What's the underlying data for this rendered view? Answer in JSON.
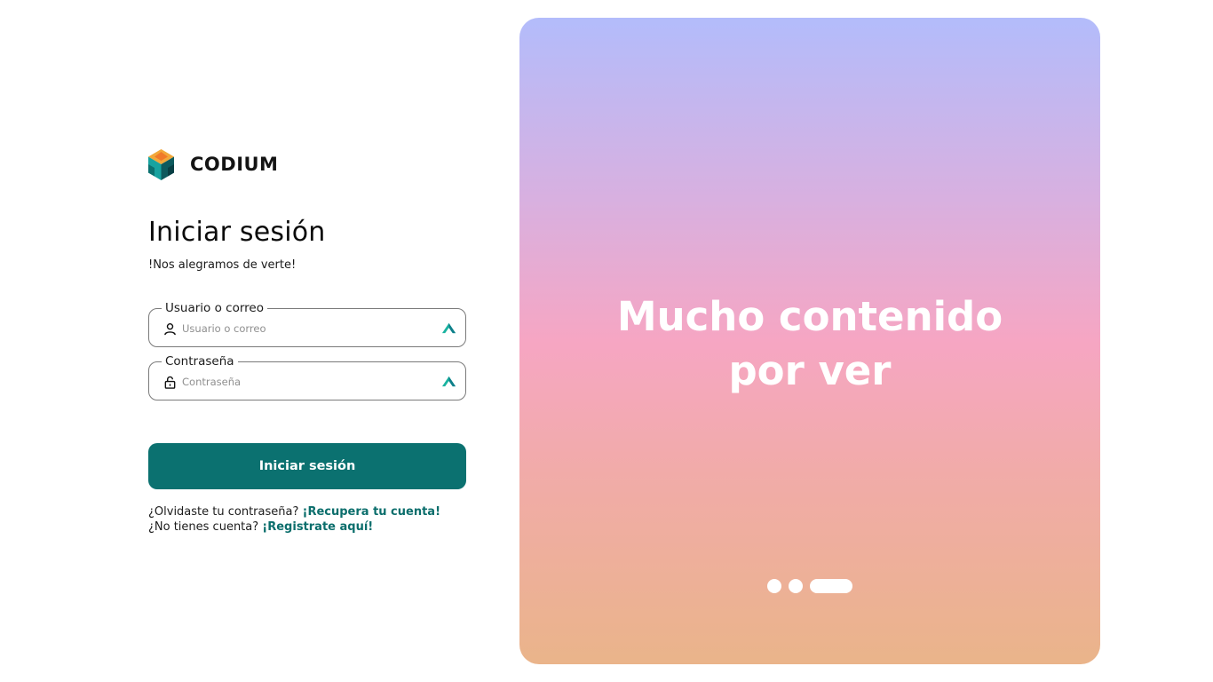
{
  "brand": {
    "name": "CODIUM",
    "logo_icon": "cube-logo-icon"
  },
  "login": {
    "title": "Iniciar sesión",
    "subtitle": "!Nos alegramos de verte!",
    "username": {
      "label": "Usuario o correo",
      "placeholder": "Usuario o correo",
      "value": "",
      "icon": "user-icon"
    },
    "password": {
      "label": "Contraseña",
      "placeholder": "Contraseña",
      "value": "",
      "icon": "lock-icon"
    },
    "submit_label": "Iniciar sesión",
    "forgot_text": "¿Olvidaste tu contraseña?",
    "forgot_link": "¡Recupera tu cuenta!",
    "register_text": "¿No tienes cuenta?",
    "register_link": "¡Registrate aquí!"
  },
  "hero": {
    "text": "Mucho contenido por ver",
    "slides": 3,
    "active_slide": 3
  },
  "colors": {
    "accent": "#0b7170",
    "link": "#0b6e6c",
    "gradient_top": "#b3bcfb",
    "gradient_mid": "#f6a6c3",
    "gradient_bottom": "#eab48a"
  }
}
